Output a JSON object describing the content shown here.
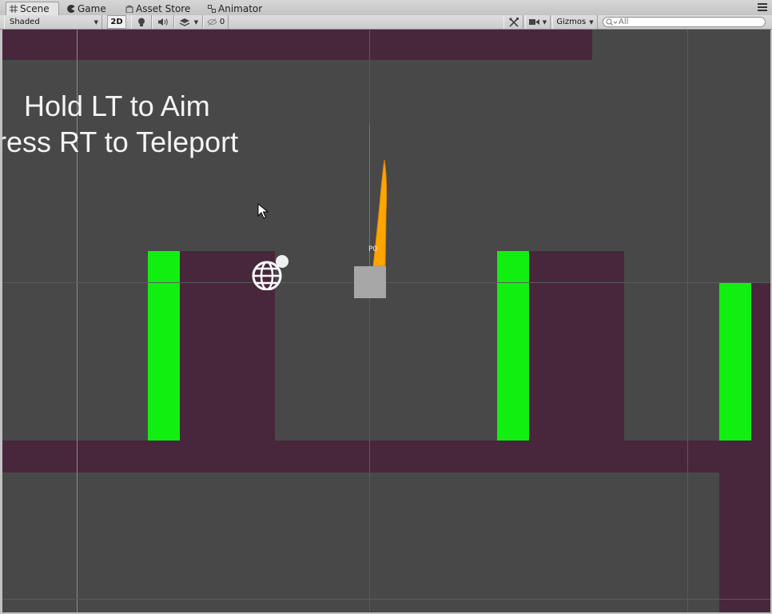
{
  "tabs": [
    {
      "label": "Scene",
      "icon": "grid-icon"
    },
    {
      "label": "Game",
      "icon": "pacman-icon"
    },
    {
      "label": "Asset Store",
      "icon": "shopping-bag-icon"
    },
    {
      "label": "Animator",
      "icon": "animator-icon"
    }
  ],
  "toolbar": {
    "draw_mode": "Shaded",
    "mode_2d_label": "2D",
    "hidden_count": "0",
    "gizmos_label": "Gizmos",
    "search_placeholder": "All"
  },
  "scene": {
    "hint_line1": "Hold LT to Aim",
    "hint_line2": "Press RT to Teleport",
    "player_label": "P0",
    "colors": {
      "background": "#484848",
      "wall": "#48273c",
      "pad": "#11ef11",
      "player_trail": "#ffa500",
      "player_box": "#a7a7a7"
    }
  }
}
